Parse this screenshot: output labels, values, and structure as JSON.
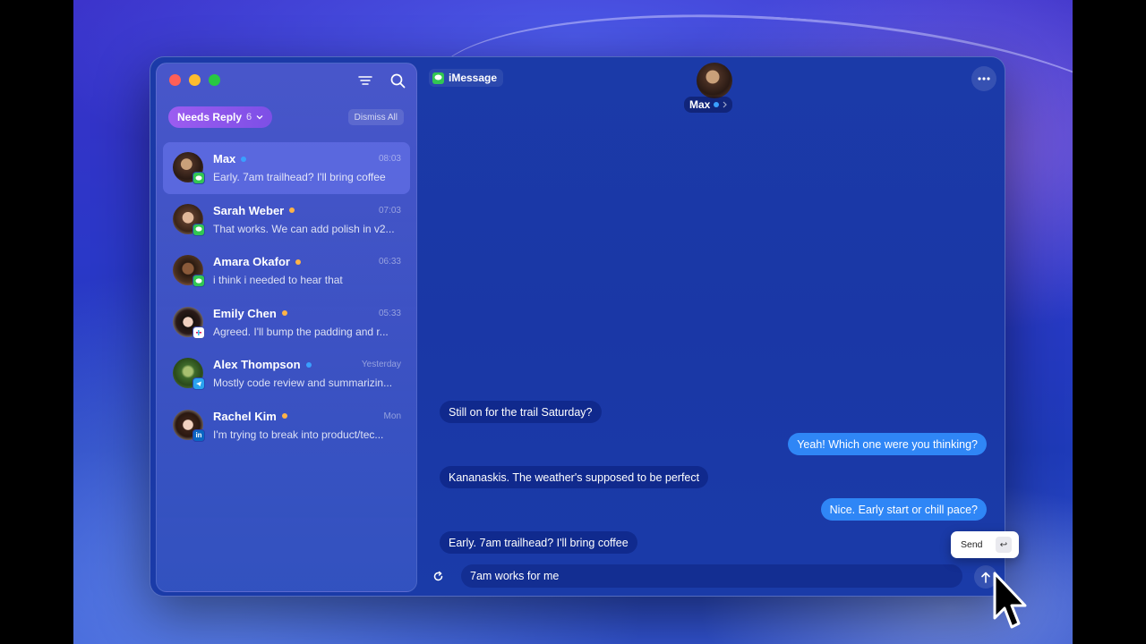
{
  "sidebar": {
    "filter": {
      "label": "Needs Reply",
      "count": "6"
    },
    "dismiss_label": "Dismiss All",
    "conversations": [
      {
        "name": "Max",
        "time": "08:03",
        "preview": "Early. 7am trailhead? I'll bring coffee",
        "dot_color": "#3aa0ff",
        "app": "imessage-icon",
        "active": true
      },
      {
        "name": "Sarah Weber",
        "time": "07:03",
        "preview": "That works. We can add polish in v2...",
        "dot_color": "#ffb347",
        "app": "imessage-icon"
      },
      {
        "name": "Amara Okafor",
        "time": "06:33",
        "preview": "i think i needed to hear that",
        "dot_color": "#ffb347",
        "app": "imessage-icon"
      },
      {
        "name": "Emily Chen",
        "time": "05:33",
        "preview": "Agreed. I'll bump the padding and r...",
        "dot_color": "#ffb347",
        "app": "slack-icon"
      },
      {
        "name": "Alex Thompson",
        "time": "Yesterday",
        "preview": "Mostly code review and summarizin...",
        "dot_color": "#3aa0ff",
        "app": "telegram-icon"
      },
      {
        "name": "Rachel Kim",
        "time": "Mon",
        "preview": "I'm trying to break into product/tec...",
        "dot_color": "#ffb347",
        "app": "linkedin-icon"
      }
    ]
  },
  "chat": {
    "service_label": "iMessage",
    "contact_name": "Max",
    "messages": [
      {
        "direction": "in",
        "text": "Still on for the trail Saturday?"
      },
      {
        "direction": "out",
        "text": "Yeah! Which one were you thinking?"
      },
      {
        "direction": "in",
        "text": "Kananaskis. The weather's supposed to be perfect"
      },
      {
        "direction": "out",
        "text": "Nice. Early start or chill pace?"
      },
      {
        "direction": "in",
        "text": "Early. 7am trailhead? I'll bring coffee"
      }
    ],
    "composer_value": "7am works for me",
    "send_tooltip": "Send",
    "send_key": "↩"
  }
}
